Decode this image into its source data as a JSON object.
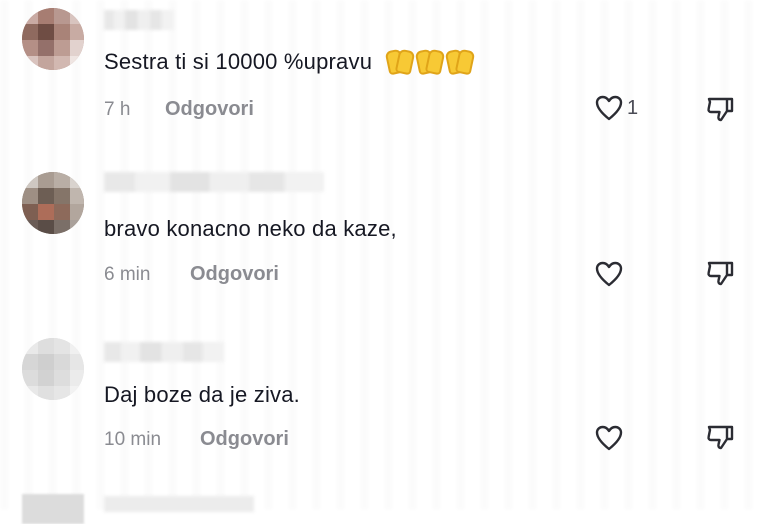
{
  "comments": [
    {
      "text": "Sestra ti si 10000 %upravu",
      "emojis": [
        "hands-emoji",
        "hands-emoji",
        "hands-emoji"
      ],
      "time": "7 h",
      "reply_label": "Odgovori",
      "like_count": "1",
      "liked_icon": "heart-outline-icon",
      "dislike_icon": "thumbs-down-outline-icon"
    },
    {
      "text": "bravo konacno neko da kaze,",
      "time": "6 min",
      "reply_label": "Odgovori",
      "like_count": "",
      "liked_icon": "heart-outline-icon",
      "dislike_icon": "thumbs-down-outline-icon"
    },
    {
      "text": "Daj boze da je ziva.",
      "time": "10 min",
      "reply_label": "Odgovori",
      "like_count": "",
      "liked_icon": "heart-outline-icon",
      "dislike_icon": "thumbs-down-outline-icon"
    }
  ],
  "colors": {
    "text": "#161823",
    "meta": "#8a8b91",
    "icon": "#2b2c33",
    "emoji": "#f7c935"
  }
}
